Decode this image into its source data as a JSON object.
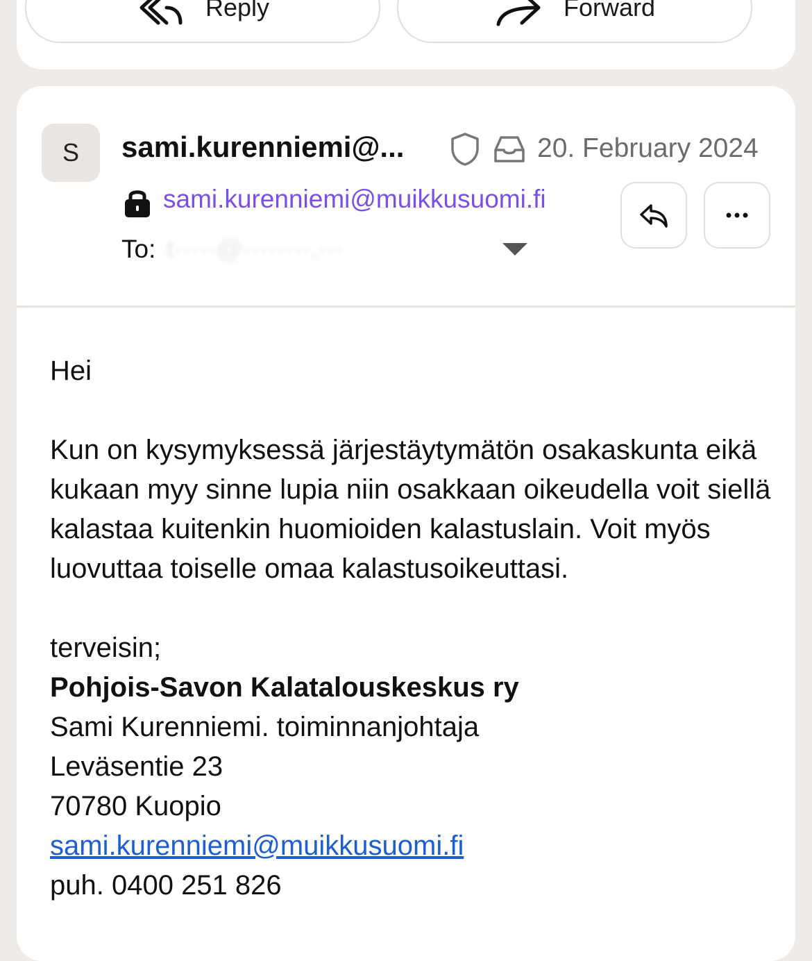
{
  "actions": {
    "reply_label": "Reply",
    "forward_label": "Forward"
  },
  "header": {
    "avatar_initial": "S",
    "sender_name": "sami.kurenniemi@...",
    "date": "20. February 2024",
    "sender_email": "sami.kurenniemi@muikkusuomi.fi",
    "to_label": "To:",
    "to_value": "t·····@········.···",
    "icons": [
      "shield-icon",
      "inbox-icon",
      "lock-icon",
      "reply-icon",
      "more-icon",
      "chevron-down-icon"
    ]
  },
  "body": {
    "greeting": "Hei",
    "paragraph": "Kun on kysymyksessä järjestäytymätön osakaskunta eikä kukaan myy sinne lupia niin osakkaan oikeudella voit siellä kalastaa kuitenkin huomioiden kalastuslain. Voit myös luovuttaa toiselle omaa kalastusoikeuttasi.",
    "closing": "terveisin;",
    "org": "Pohjois-Savon Kalatalouskeskus ry",
    "signer": "Sami Kurenniemi. toiminnanjohtaja",
    "street": "Leväsentie 23",
    "city": "70780 Kuopio",
    "email": "sami.kurenniemi@muikkusuomi.fi",
    "phone": "puh. 0400 251 826"
  },
  "colors": {
    "background": "#efebe8",
    "card": "#ffffff",
    "sender_email": "#7a4fe8",
    "link": "#1d5fd1",
    "date": "#6b6b6b"
  }
}
